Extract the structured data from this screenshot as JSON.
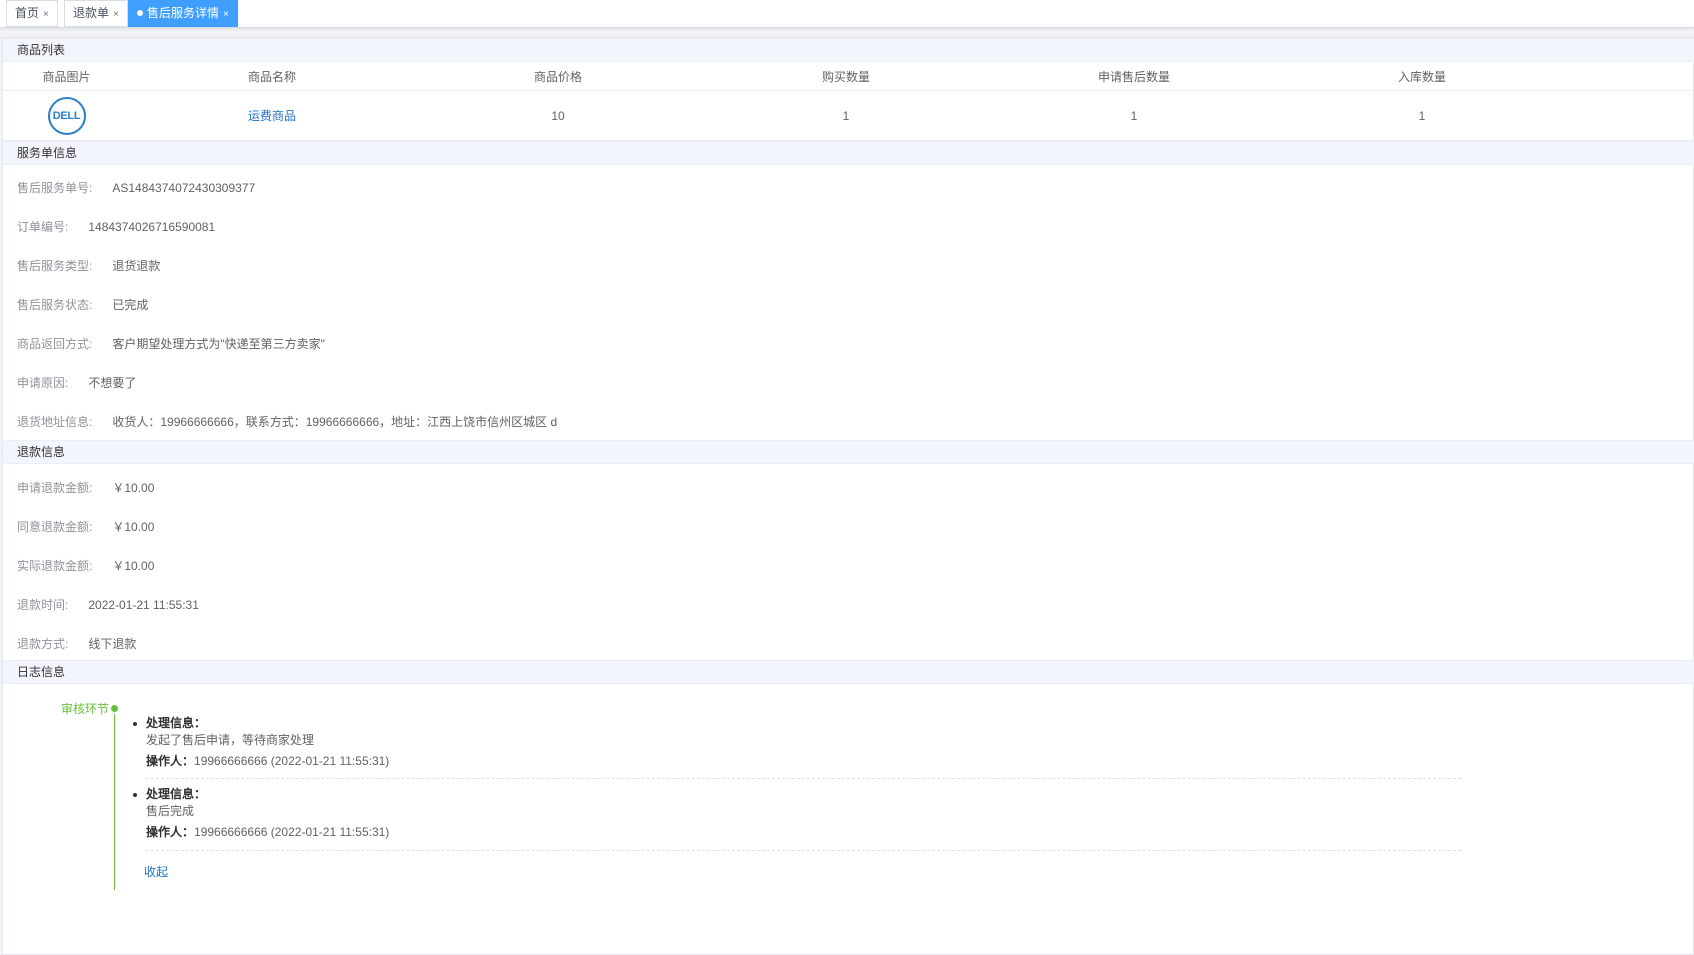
{
  "tabs": [
    {
      "label": "首页",
      "close": "×"
    },
    {
      "label": "退款单",
      "close": "×"
    },
    {
      "label": "售后服务详情",
      "close": "×"
    }
  ],
  "products": {
    "section_title": "商品列表",
    "columns": [
      "商品图片",
      "商品名称",
      "商品价格",
      "购买数量",
      "申请售后数量",
      "入库数量"
    ],
    "rows": [
      {
        "image_logo": "DELL",
        "name": "运费商品",
        "price": "10",
        "buy_qty": "1",
        "apply_qty": "1",
        "stock_qty": "1"
      }
    ]
  },
  "service": {
    "section_title": "服务单信息",
    "fields": [
      {
        "label": "售后服务单号:",
        "value": "AS1484374072430309377"
      },
      {
        "label": "订单编号:",
        "value": "1484374026716590081"
      },
      {
        "label": "售后服务类型:",
        "value": "退货退款"
      },
      {
        "label": "售后服务状态:",
        "value": "已完成"
      },
      {
        "label": "商品返回方式:",
        "value": "客户期望处理方式为\"快递至第三方卖家\""
      },
      {
        "label": "申请原因:",
        "value": "不想要了"
      },
      {
        "label": "退货地址信息:",
        "value": "收货人：19966666666，联系方式：19966666666，地址：江西上饶市信州区城区 d"
      }
    ]
  },
  "refund": {
    "section_title": "退款信息",
    "fields": [
      {
        "label": "申请退款金额:",
        "value": "￥10.00"
      },
      {
        "label": "同意退款金额:",
        "value": "￥10.00"
      },
      {
        "label": "实际退款金额:",
        "value": "￥10.00"
      },
      {
        "label": "退款时间:",
        "value": "2022-01-21 11:55:31"
      },
      {
        "label": "退款方式:",
        "value": "线下退款"
      }
    ]
  },
  "logs": {
    "section_title": "日志信息",
    "stage": "审核环节",
    "info_label": "处理信息：",
    "operator_label": "操作人：",
    "entries": [
      {
        "info": "发起了售后申请，等待商家处理",
        "operator": "19966666666 (2022-01-21 11:55:31)"
      },
      {
        "info": "售后完成",
        "operator": "19966666666 (2022-01-21 11:55:31)"
      }
    ],
    "collapse_label": "收起"
  },
  "colors": {
    "accent": "#409eff",
    "link": "#1f6fc5",
    "timeline": "#67c23a"
  }
}
